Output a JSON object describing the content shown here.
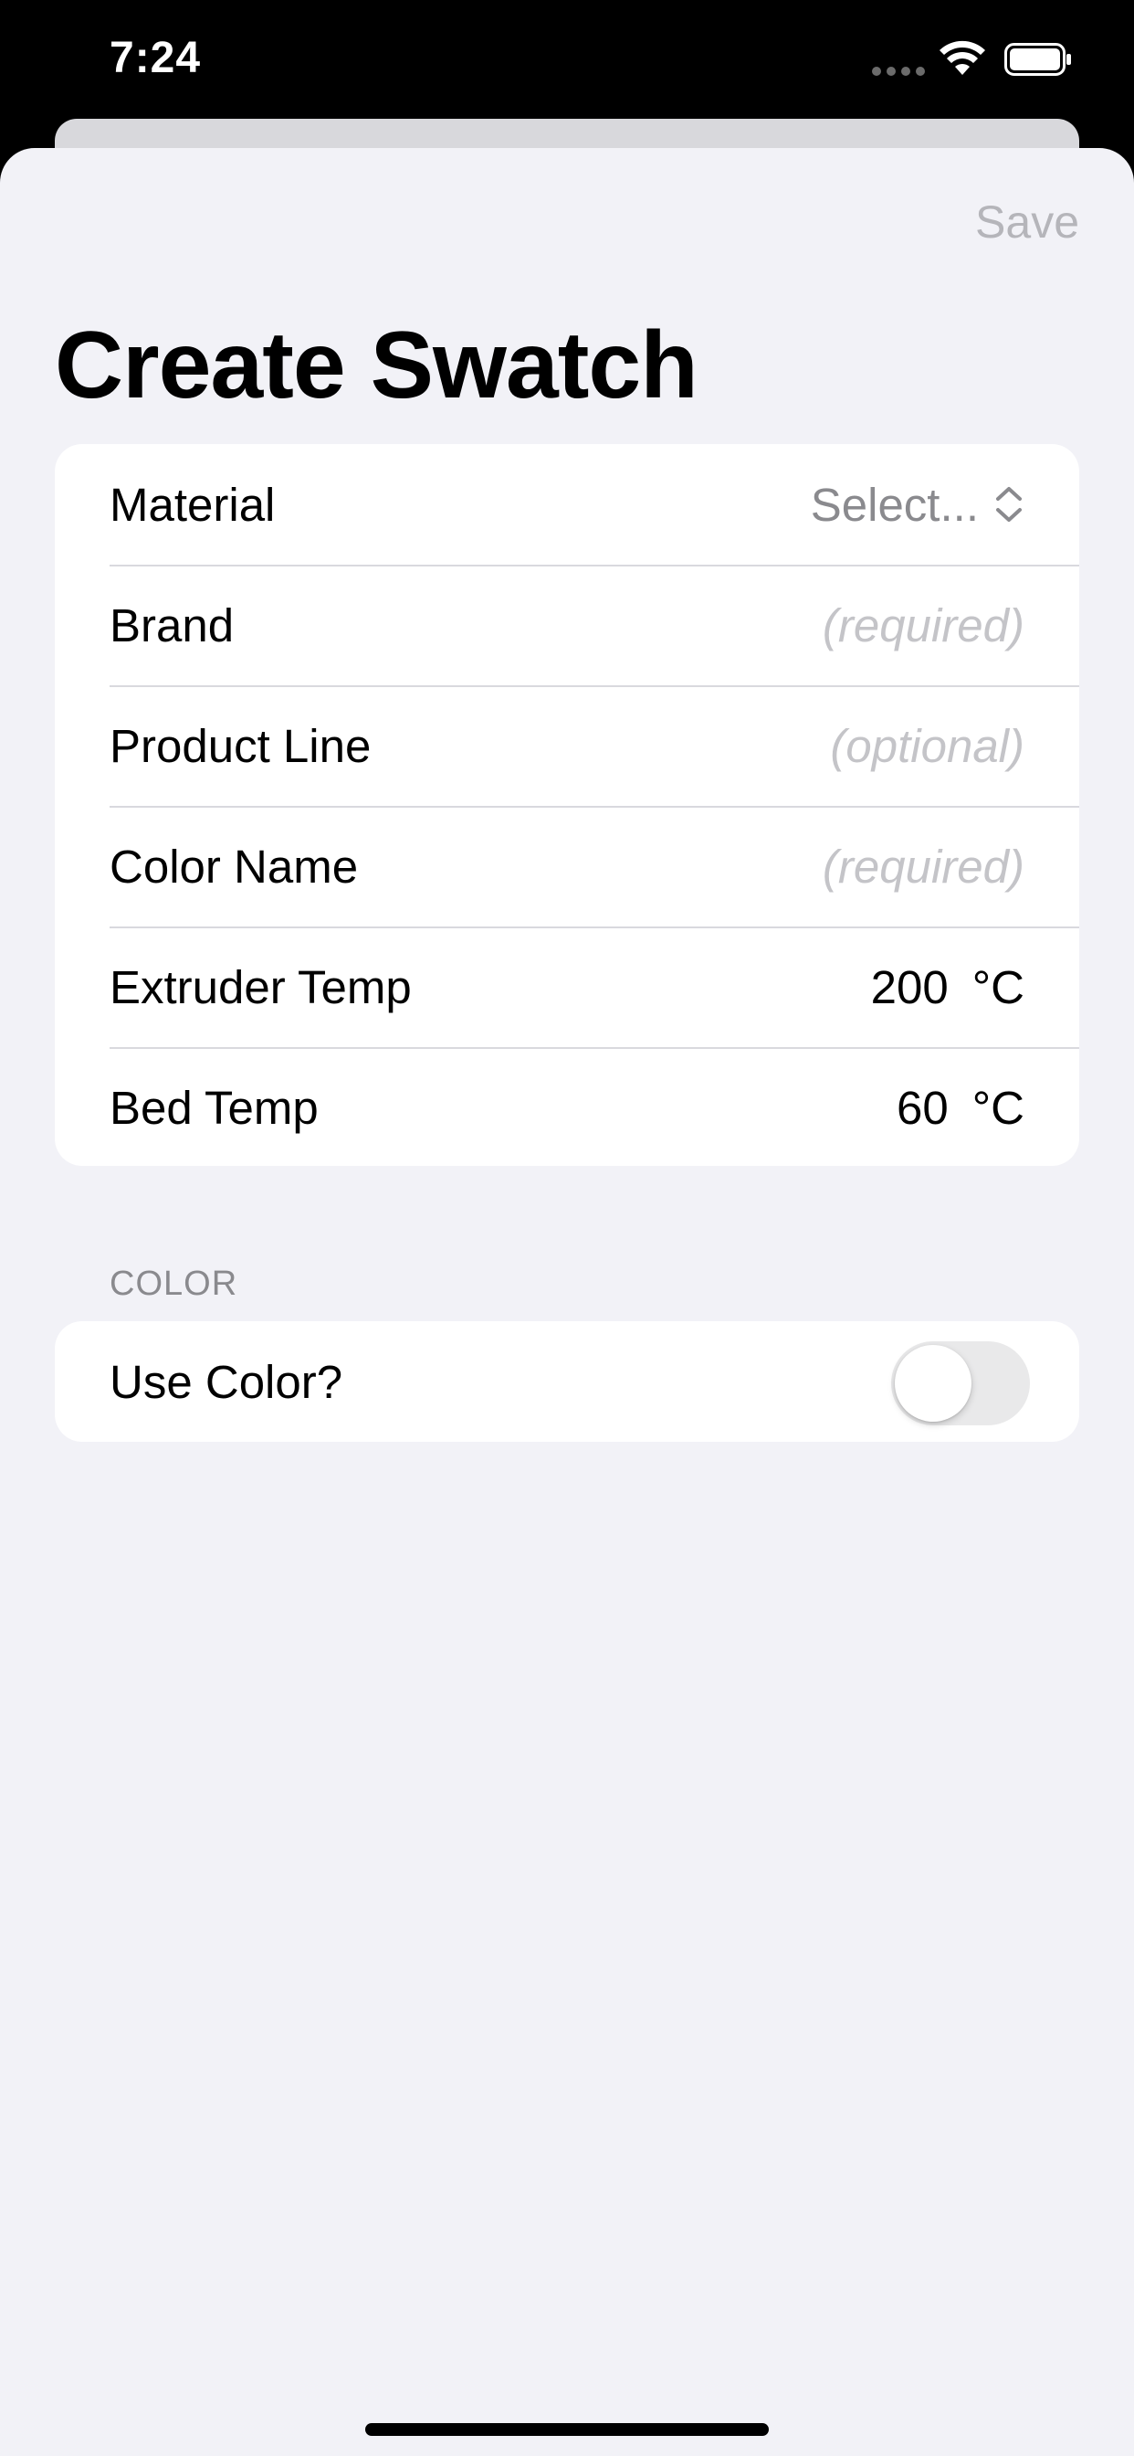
{
  "status_bar": {
    "time": "7:24"
  },
  "nav": {
    "save_label": "Save"
  },
  "title": "Create Swatch",
  "form": {
    "material": {
      "label": "Material",
      "value": "Select..."
    },
    "brand": {
      "label": "Brand",
      "placeholder": "(required)"
    },
    "product_line": {
      "label": "Product Line",
      "placeholder": "(optional)"
    },
    "color_name": {
      "label": "Color Name",
      "placeholder": "(required)"
    },
    "extruder_temp": {
      "label": "Extruder Temp",
      "value": "200",
      "unit": "°C"
    },
    "bed_temp": {
      "label": "Bed Temp",
      "value": "60",
      "unit": "°C"
    }
  },
  "color_section": {
    "header": "COLOR",
    "use_color": {
      "label": "Use Color?",
      "enabled": false
    }
  },
  "colors": {
    "background": "#f2f2f7",
    "card": "#ffffff",
    "placeholder": "#c4c4c8",
    "secondary_text": "#8a8a8e",
    "save_disabled": "#b5b5ba"
  }
}
